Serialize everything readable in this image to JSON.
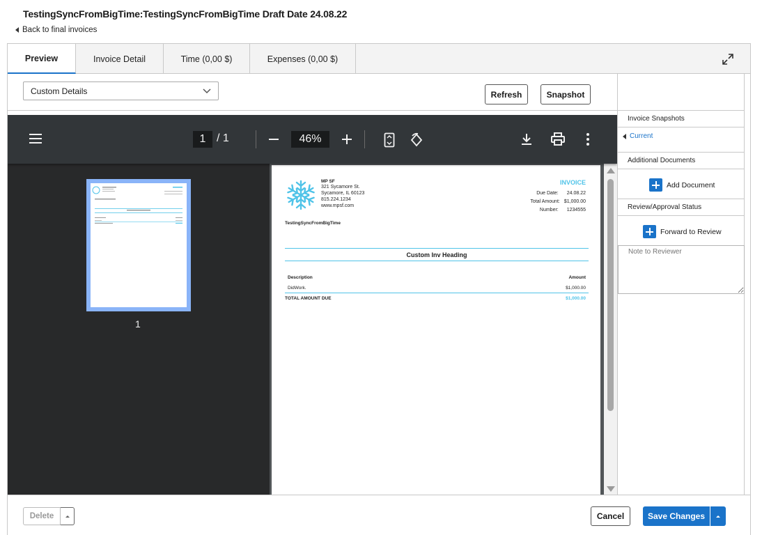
{
  "page": {
    "title": "TestingSyncFromBigTime:TestingSyncFromBigTime Draft Date 24.08.22",
    "back_link": "Back to final invoices"
  },
  "tabs": [
    {
      "label": "Preview",
      "active": true
    },
    {
      "label": "Invoice Detail",
      "active": false
    },
    {
      "label": "Time (0,00 $)",
      "active": false
    },
    {
      "label": "Expenses (0,00 $)",
      "active": false
    }
  ],
  "toolbar": {
    "select_value": "Custom Details",
    "refresh_label": "Refresh",
    "snapshot_label": "Snapshot"
  },
  "viewer": {
    "page_current": "1",
    "page_total": "/  1",
    "zoom": "46%",
    "thumb_number": "1"
  },
  "invoice": {
    "company": "MP SF",
    "address1": "321 Sycamore St.",
    "address2": "Sycamore, IL 60123",
    "phone": "815.224.1234",
    "web": "www.mpsf.com",
    "heading": "INVOICE",
    "due_date_label": "Due Date:",
    "due_date": "24.08.22",
    "total_label": "Total Amount:",
    "total": "$1,000.00",
    "number_label": "Number:",
    "number": "1234555",
    "client": "TestingSyncFromBigTime",
    "section_heading": "Custom Inv Heading",
    "col_description": "Description",
    "col_amount": "Amount",
    "line_desc": "DidWork.",
    "line_amount": "$1,000.00",
    "total_due_label": "TOTAL AMOUNT DUE",
    "total_due": "$1,000.00"
  },
  "side": {
    "snapshots_header": "Invoice Snapshots",
    "current_label": "Current",
    "additional_header": "Additional Documents",
    "add_document_label": "Add Document",
    "review_header": "Review/Approval Status",
    "forward_label": "Forward to Review",
    "note_placeholder": "Note to Reviewer"
  },
  "footer": {
    "delete_label": "Delete",
    "cancel_label": "Cancel",
    "save_label": "Save Changes"
  },
  "colors": {
    "accent": "#1a73c9",
    "invoice_accent": "#4fc3e8",
    "viewer_bg": "#323639"
  }
}
